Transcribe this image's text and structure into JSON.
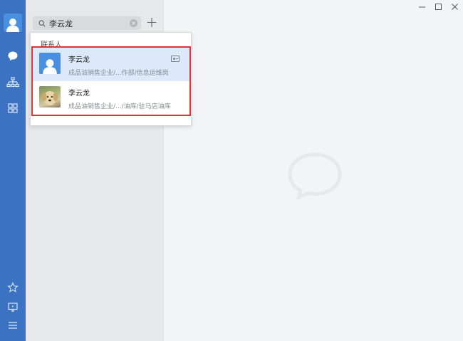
{
  "window": {
    "controls": [
      "minimize",
      "maximize",
      "close"
    ]
  },
  "nav": {
    "icons": [
      "avatar-icon",
      "chat-icon",
      "org-chart-icon",
      "apps-icon",
      "star-icon",
      "monitor-icon",
      "menu-icon"
    ]
  },
  "search": {
    "value": "李云龙",
    "placeholder": ""
  },
  "dropdown": {
    "section_label": "联系人",
    "results": [
      {
        "name": "李云龙",
        "dept": "成品油销售企业/...作部/信息运维岗",
        "avatar": "default-person",
        "selected": true
      },
      {
        "name": "李云龙",
        "dept": "成品油销售企业/.../油库/驻马店油库",
        "avatar": "dog-photo",
        "selected": false
      }
    ]
  },
  "colors": {
    "nav_bg": "#3b73c2",
    "highlight_border": "#d9363e",
    "selected_row": "#dbe9fa"
  }
}
